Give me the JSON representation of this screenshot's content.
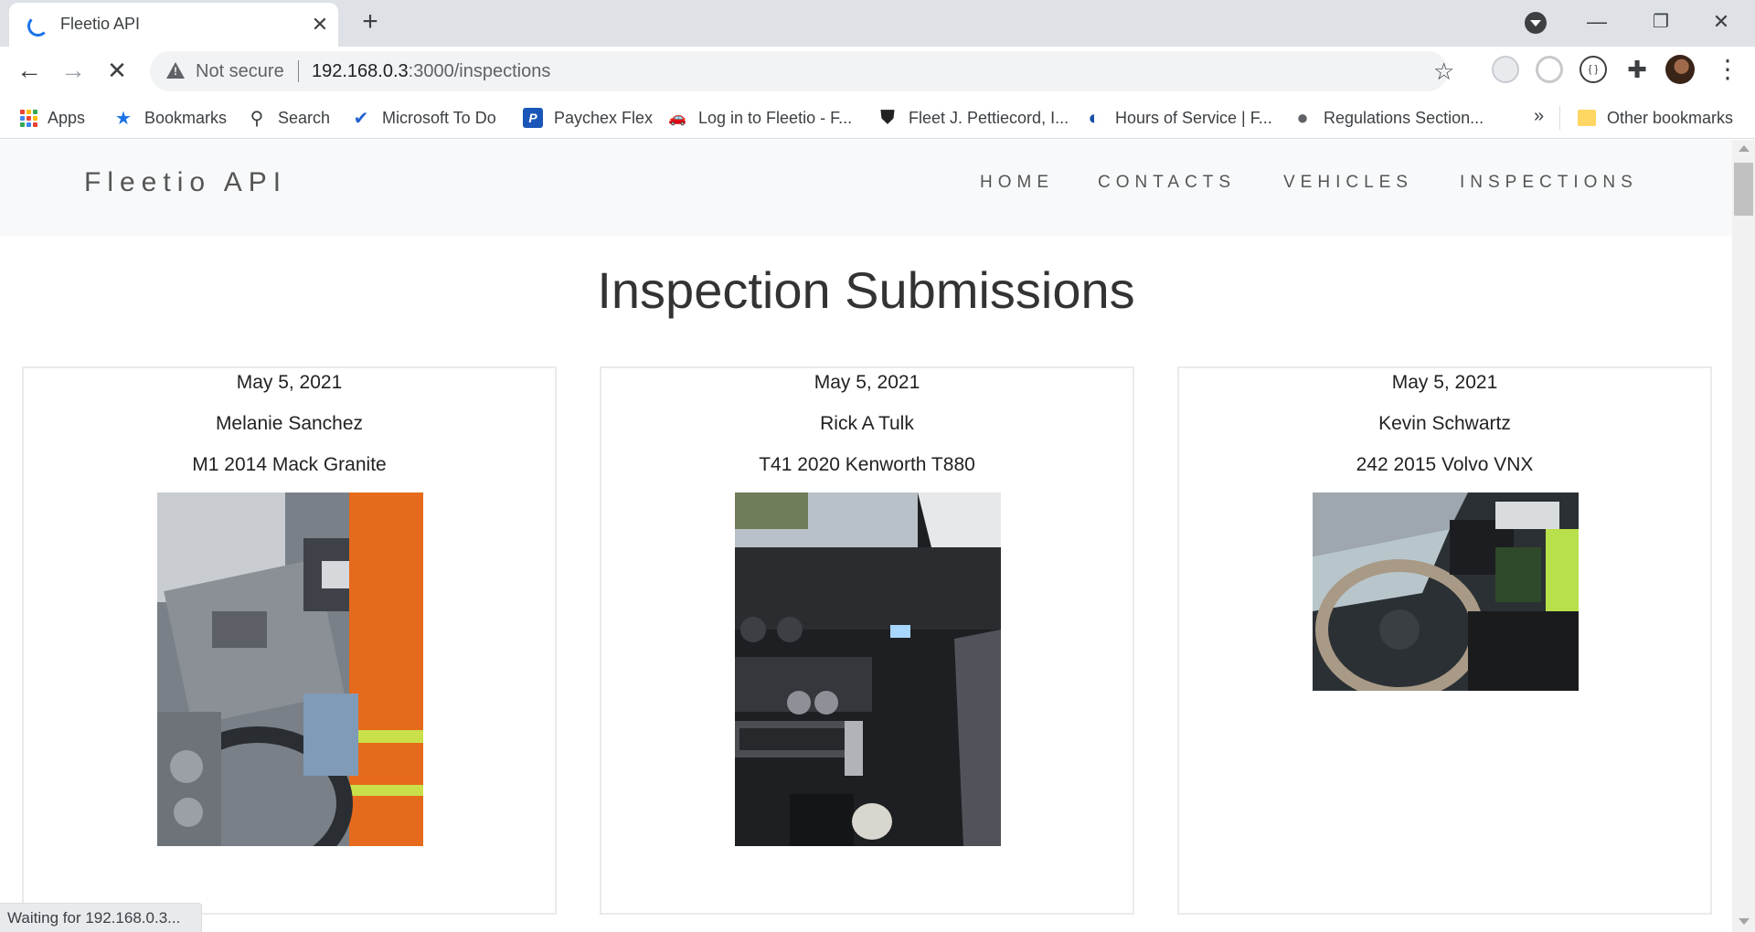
{
  "browser": {
    "tab": {
      "title": "Fleetio API",
      "close": "✕"
    },
    "new_tab": "+",
    "window_controls": {
      "minimize": "—",
      "restore": "❐",
      "close": "✕"
    },
    "toolbar": {
      "back": "←",
      "forward": "→",
      "stop": "✕",
      "security_label": "Not secure",
      "url_host": "192.168.0.3",
      "url_rest": ":3000/inspections",
      "star": "☆",
      "menu": "⋮"
    },
    "bookmarks": [
      {
        "label": "Apps",
        "icon": "apps-grid-icon"
      },
      {
        "label": "Bookmarks",
        "icon": "star-icon",
        "glyph": "★",
        "color": "#1a73e8"
      },
      {
        "label": "Search",
        "icon": "search-icon",
        "glyph": "⚲",
        "color": "#3c4043"
      },
      {
        "label": "Microsoft To Do",
        "icon": "check-icon",
        "glyph": "✔",
        "color": "#2564cf"
      },
      {
        "label": "Paychex Flex",
        "icon": "paychex-icon",
        "glyph": "P",
        "color": "#1a56b8"
      },
      {
        "label": "Log in to Fleetio - F...",
        "icon": "car-icon",
        "glyph": "🚗",
        "color": "#2e7d32"
      },
      {
        "label": "Fleet J. Pettiecord, I...",
        "icon": "shield-icon",
        "glyph": "⛊",
        "color": "#222222"
      },
      {
        "label": "Hours of Service | F...",
        "icon": "dot-logo-icon",
        "glyph": "◐",
        "color": "#1a4ea8"
      },
      {
        "label": "Regulations Section...",
        "icon": "globe-icon",
        "glyph": "●",
        "color": "#5f6368"
      }
    ],
    "bookmarks_overflow": "»",
    "other_bookmarks": "Other bookmarks",
    "status": "Waiting for 192.168.0.3..."
  },
  "site": {
    "brand": "Fleetio API",
    "nav": [
      "HOME",
      "CONTACTS",
      "VEHICLES",
      "INSPECTIONS"
    ],
    "page_title": "Inspection Submissions",
    "inspections": [
      {
        "date": "May 5, 2021",
        "driver": "Melanie Sanchez",
        "vehicle": "M1 2014 Mack Granite",
        "photo": "truck-cab-interior-photo-1"
      },
      {
        "date": "May 5, 2021",
        "driver": "Rick A Tulk",
        "vehicle": "T41 2020 Kenworth T880",
        "photo": "truck-cab-interior-photo-2"
      },
      {
        "date": "May 5, 2021",
        "driver": "Kevin Schwartz",
        "vehicle": "242 2015 Volvo VNX",
        "photo": "truck-cab-interior-photo-3"
      }
    ]
  },
  "colors": {
    "accent": "#1a73e8",
    "navbar_bg": "#f8f9fa",
    "tabstrip_bg": "#dee1e6"
  }
}
